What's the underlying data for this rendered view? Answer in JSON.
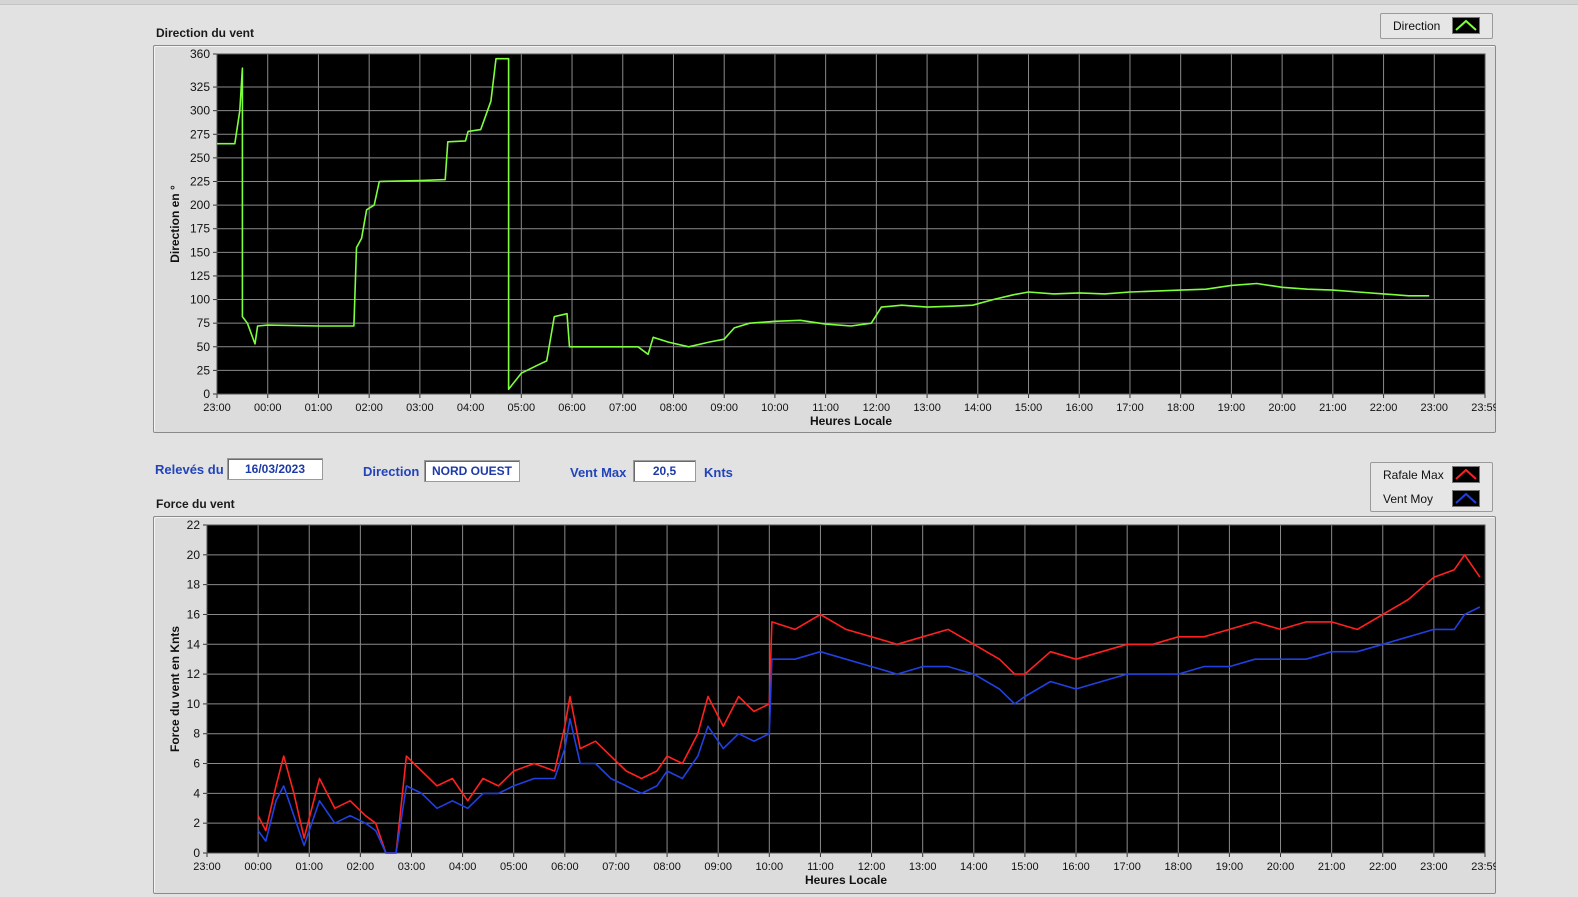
{
  "top_chart": {
    "title": "Direction du vent",
    "ylabel": "Direction en °",
    "xlabel": "Heures Locale",
    "legend": [
      {
        "label": "Direction",
        "color": "#7dff3c"
      }
    ]
  },
  "bottom_chart": {
    "title": "Force du vent",
    "ylabel": "Force du vent en Knts",
    "xlabel": "Heures Locale",
    "legend": [
      {
        "label": "Rafale Max",
        "color": "#ff2020"
      },
      {
        "label": "Vent Moy",
        "color": "#2040e0"
      }
    ]
  },
  "controls": {
    "releves_label": "Relevés du",
    "releves_value": "16/03/2023",
    "direction_label": "Direction",
    "direction_value": "NORD OUEST",
    "ventmax_label": "Vent Max",
    "ventmax_value": "20,5",
    "ventmax_unit": "Knts"
  },
  "chart_data": [
    {
      "type": "line",
      "title": "Direction du vent",
      "xlabel": "Heures Locale",
      "ylabel": "Direction en °",
      "x_ticks": [
        "23:00",
        "00:00",
        "01:00",
        "02:00",
        "03:00",
        "04:00",
        "05:00",
        "06:00",
        "07:00",
        "08:00",
        "09:00",
        "10:00",
        "11:00",
        "12:00",
        "13:00",
        "14:00",
        "15:00",
        "16:00",
        "17:00",
        "18:00",
        "19:00",
        "20:00",
        "21:00",
        "22:00",
        "23:00",
        "23:59"
      ],
      "y_ticks": [
        0,
        25,
        50,
        75,
        100,
        125,
        150,
        175,
        200,
        225,
        250,
        275,
        300,
        325,
        360
      ],
      "ylim": [
        0,
        360
      ],
      "grid": true,
      "legend_position": "top-right",
      "series": [
        {
          "name": "Direction",
          "color": "#7dff3c",
          "points": [
            [
              0.0,
              265
            ],
            [
              0.35,
              265
            ],
            [
              0.45,
              300
            ],
            [
              0.5,
              345
            ],
            [
              0.5,
              82
            ],
            [
              0.6,
              75
            ],
            [
              0.75,
              53
            ],
            [
              0.8,
              72
            ],
            [
              1.0,
              73
            ],
            [
              2.0,
              72
            ],
            [
              2.7,
              72
            ],
            [
              2.75,
              155
            ],
            [
              2.85,
              165
            ],
            [
              2.95,
              195
            ],
            [
              3.1,
              200
            ],
            [
              3.2,
              225
            ],
            [
              4.0,
              226
            ],
            [
              4.5,
              227
            ],
            [
              4.55,
              267
            ],
            [
              4.9,
              268
            ],
            [
              4.95,
              278
            ],
            [
              5.2,
              280
            ],
            [
              5.4,
              310
            ],
            [
              5.5,
              355
            ],
            [
              5.75,
              355
            ],
            [
              5.75,
              5
            ],
            [
              6.0,
              22
            ],
            [
              6.3,
              30
            ],
            [
              6.5,
              35
            ],
            [
              6.65,
              82
            ],
            [
              6.9,
              85
            ],
            [
              6.95,
              50
            ],
            [
              8.0,
              50
            ],
            [
              8.3,
              50
            ],
            [
              8.5,
              42
            ],
            [
              8.6,
              60
            ],
            [
              8.9,
              55
            ],
            [
              9.3,
              50
            ],
            [
              9.7,
              55
            ],
            [
              10.0,
              58
            ],
            [
              10.2,
              70
            ],
            [
              10.5,
              75
            ],
            [
              11.0,
              77
            ],
            [
              11.5,
              78
            ],
            [
              12.0,
              74
            ],
            [
              12.5,
              72
            ],
            [
              12.9,
              75
            ],
            [
              13.1,
              92
            ],
            [
              13.5,
              94
            ],
            [
              14.0,
              92
            ],
            [
              14.5,
              93
            ],
            [
              14.9,
              94
            ],
            [
              15.3,
              100
            ],
            [
              15.7,
              105
            ],
            [
              16.0,
              108
            ],
            [
              16.5,
              106
            ],
            [
              17.0,
              107
            ],
            [
              17.5,
              106
            ],
            [
              18.0,
              108
            ],
            [
              18.5,
              109
            ],
            [
              19.0,
              110
            ],
            [
              19.5,
              111
            ],
            [
              20.0,
              115
            ],
            [
              20.5,
              117
            ],
            [
              21.0,
              113
            ],
            [
              21.5,
              111
            ],
            [
              22.0,
              110
            ],
            [
              22.5,
              108
            ],
            [
              23.0,
              106
            ],
            [
              23.5,
              104
            ],
            [
              23.9,
              104
            ]
          ]
        }
      ]
    },
    {
      "type": "line",
      "title": "Force du vent",
      "xlabel": "Heures Locale",
      "ylabel": "Force du vent en Knts",
      "x_ticks": [
        "23:00",
        "00:00",
        "01:00",
        "02:00",
        "03:00",
        "04:00",
        "05:00",
        "06:00",
        "07:00",
        "08:00",
        "09:00",
        "10:00",
        "11:00",
        "12:00",
        "13:00",
        "14:00",
        "15:00",
        "16:00",
        "17:00",
        "18:00",
        "19:00",
        "20:00",
        "21:00",
        "22:00",
        "23:00",
        "23:59"
      ],
      "y_ticks": [
        0,
        2,
        4,
        6,
        8,
        10,
        12,
        14,
        16,
        18,
        20,
        22
      ],
      "ylim": [
        0,
        22
      ],
      "grid": true,
      "legend_position": "top-right",
      "series": [
        {
          "name": "Rafale Max",
          "color": "#ff2020",
          "points": [
            [
              1.0,
              2.5
            ],
            [
              1.15,
              1.5
            ],
            [
              1.35,
              4.5
            ],
            [
              1.5,
              6.5
            ],
            [
              1.7,
              4.0
            ],
            [
              1.9,
              1.0
            ],
            [
              2.2,
              5.0
            ],
            [
              2.5,
              3.0
            ],
            [
              2.8,
              3.5
            ],
            [
              3.1,
              2.5
            ],
            [
              3.3,
              2.0
            ],
            [
              3.5,
              0.0
            ],
            [
              3.7,
              0.0
            ],
            [
              3.9,
              6.5
            ],
            [
              4.2,
              5.5
            ],
            [
              4.5,
              4.5
            ],
            [
              4.8,
              5.0
            ],
            [
              5.1,
              3.5
            ],
            [
              5.4,
              5.0
            ],
            [
              5.7,
              4.5
            ],
            [
              6.0,
              5.5
            ],
            [
              6.4,
              6.0
            ],
            [
              6.8,
              5.5
            ],
            [
              7.0,
              8.5
            ],
            [
              7.1,
              10.5
            ],
            [
              7.3,
              7.0
            ],
            [
              7.6,
              7.5
            ],
            [
              7.9,
              6.5
            ],
            [
              8.2,
              5.5
            ],
            [
              8.5,
              5.0
            ],
            [
              8.8,
              5.5
            ],
            [
              9.0,
              6.5
            ],
            [
              9.3,
              6.0
            ],
            [
              9.6,
              8.0
            ],
            [
              9.8,
              10.5
            ],
            [
              10.1,
              8.5
            ],
            [
              10.4,
              10.5
            ],
            [
              10.7,
              9.5
            ],
            [
              11.0,
              10.0
            ],
            [
              11.05,
              15.5
            ],
            [
              11.5,
              15.0
            ],
            [
              12.0,
              16.0
            ],
            [
              12.5,
              15.0
            ],
            [
              13.0,
              14.5
            ],
            [
              13.5,
              14.0
            ],
            [
              14.0,
              14.5
            ],
            [
              14.5,
              15.0
            ],
            [
              15.0,
              14.0
            ],
            [
              15.5,
              13.0
            ],
            [
              15.8,
              12.0
            ],
            [
              16.0,
              12.0
            ],
            [
              16.5,
              13.5
            ],
            [
              17.0,
              13.0
            ],
            [
              17.5,
              13.5
            ],
            [
              18.0,
              14.0
            ],
            [
              18.5,
              14.0
            ],
            [
              19.0,
              14.5
            ],
            [
              19.5,
              14.5
            ],
            [
              20.0,
              15.0
            ],
            [
              20.5,
              15.5
            ],
            [
              21.0,
              15.0
            ],
            [
              21.5,
              15.5
            ],
            [
              22.0,
              15.5
            ],
            [
              22.5,
              15.0
            ],
            [
              23.0,
              16.0
            ],
            [
              23.5,
              17.0
            ],
            [
              24.0,
              18.5
            ],
            [
              24.4,
              19.0
            ],
            [
              24.6,
              20.0
            ],
            [
              24.9,
              18.5
            ]
          ]
        },
        {
          "name": "Vent Moy",
          "color": "#2040e0",
          "points": [
            [
              1.0,
              1.5
            ],
            [
              1.15,
              0.8
            ],
            [
              1.35,
              3.5
            ],
            [
              1.5,
              4.5
            ],
            [
              1.7,
              2.5
            ],
            [
              1.9,
              0.5
            ],
            [
              2.2,
              3.5
            ],
            [
              2.5,
              2.0
            ],
            [
              2.8,
              2.5
            ],
            [
              3.1,
              2.0
            ],
            [
              3.3,
              1.5
            ],
            [
              3.5,
              0.0
            ],
            [
              3.7,
              0.0
            ],
            [
              3.9,
              4.5
            ],
            [
              4.2,
              4.0
            ],
            [
              4.5,
              3.0
            ],
            [
              4.8,
              3.5
            ],
            [
              5.1,
              3.0
            ],
            [
              5.4,
              4.0
            ],
            [
              5.7,
              4.0
            ],
            [
              6.0,
              4.5
            ],
            [
              6.4,
              5.0
            ],
            [
              6.8,
              5.0
            ],
            [
              7.0,
              7.0
            ],
            [
              7.1,
              9.0
            ],
            [
              7.3,
              6.0
            ],
            [
              7.6,
              6.0
            ],
            [
              7.9,
              5.0
            ],
            [
              8.2,
              4.5
            ],
            [
              8.5,
              4.0
            ],
            [
              8.8,
              4.5
            ],
            [
              9.0,
              5.5
            ],
            [
              9.3,
              5.0
            ],
            [
              9.6,
              6.5
            ],
            [
              9.8,
              8.5
            ],
            [
              10.1,
              7.0
            ],
            [
              10.4,
              8.0
            ],
            [
              10.7,
              7.5
            ],
            [
              11.0,
              8.0
            ],
            [
              11.05,
              13.0
            ],
            [
              11.5,
              13.0
            ],
            [
              12.0,
              13.5
            ],
            [
              12.5,
              13.0
            ],
            [
              13.0,
              12.5
            ],
            [
              13.5,
              12.0
            ],
            [
              14.0,
              12.5
            ],
            [
              14.5,
              12.5
            ],
            [
              15.0,
              12.0
            ],
            [
              15.5,
              11.0
            ],
            [
              15.8,
              10.0
            ],
            [
              16.0,
              10.5
            ],
            [
              16.5,
              11.5
            ],
            [
              17.0,
              11.0
            ],
            [
              17.5,
              11.5
            ],
            [
              18.0,
              12.0
            ],
            [
              18.5,
              12.0
            ],
            [
              19.0,
              12.0
            ],
            [
              19.5,
              12.5
            ],
            [
              20.0,
              12.5
            ],
            [
              20.5,
              13.0
            ],
            [
              21.0,
              13.0
            ],
            [
              21.5,
              13.0
            ],
            [
              22.0,
              13.5
            ],
            [
              22.5,
              13.5
            ],
            [
              23.0,
              14.0
            ],
            [
              23.5,
              14.5
            ],
            [
              24.0,
              15.0
            ],
            [
              24.4,
              15.0
            ],
            [
              24.6,
              16.0
            ],
            [
              24.9,
              16.5
            ]
          ]
        }
      ]
    }
  ]
}
